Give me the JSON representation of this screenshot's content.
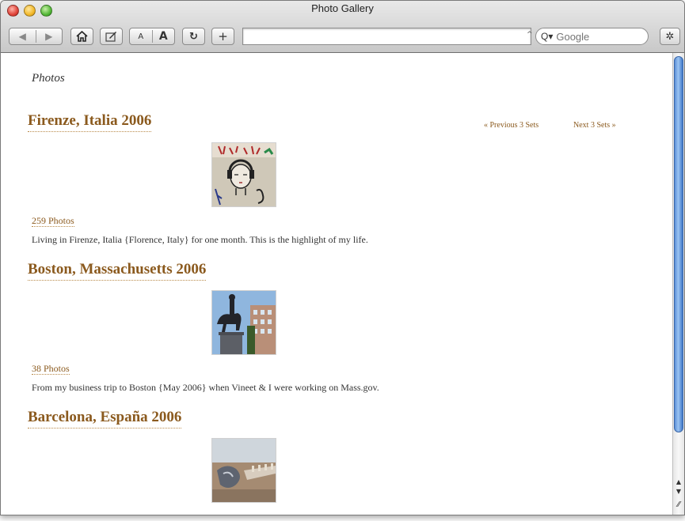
{
  "window": {
    "title": "Photo Gallery"
  },
  "toolbar": {
    "back_icon": "back-arrow-icon",
    "forward_icon": "forward-arrow-icon",
    "home_icon": "home-icon",
    "edit_icon": "edit-icon",
    "text_smaller": "A",
    "text_bigger": "A",
    "reload_icon": "reload-icon",
    "add_icon": "plus-icon",
    "bug_icon": "bug-icon",
    "address_value": "",
    "search_placeholder": "Google"
  },
  "page": {
    "title": "Photos",
    "prev_link": "« Previous 3 Sets",
    "next_link": "Next 3 Sets »",
    "sets": [
      {
        "name": "Firenze, Italia 2006",
        "count": "259 Photos",
        "description": "Living in Firenze, Italia {Florence, Italy} for one month. This is the highlight of my life."
      },
      {
        "name": "Boston, Massachusetts 2006",
        "count": "38 Photos",
        "description": "From my business trip to Boston {May 2006} when Vineet & I were working on Mass.gov."
      },
      {
        "name": "Barcelona, España 2006",
        "count": "",
        "description": ""
      }
    ]
  },
  "colors": {
    "link": "#8b5a1e",
    "scroll_thumb": "#5a8fd8"
  }
}
